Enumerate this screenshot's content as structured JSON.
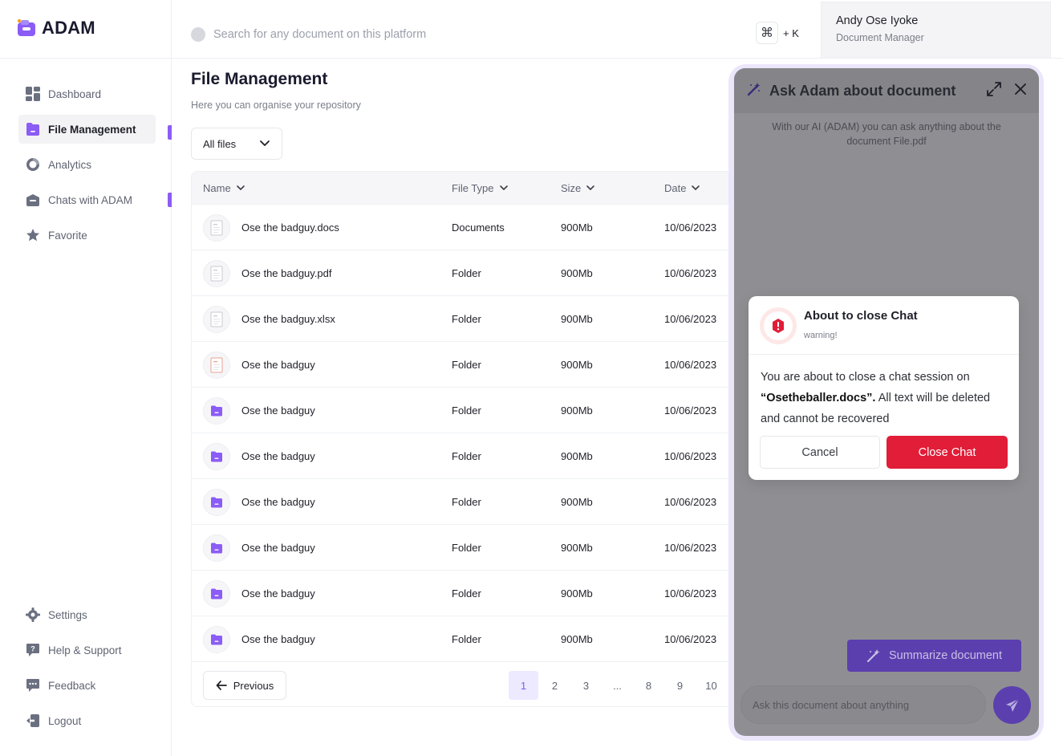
{
  "app": {
    "name": "ADAM",
    "accent": "#8b5cf6",
    "danger": "#e11d38"
  },
  "sidebar": {
    "items": [
      {
        "label": "Dashboard",
        "icon": "dashboard-icon",
        "active": false
      },
      {
        "label": "File Management",
        "icon": "folder-icon",
        "active": true
      },
      {
        "label": "Analytics",
        "icon": "analytics-icon",
        "active": false
      },
      {
        "label": "Chats with ADAM",
        "icon": "chat-box-icon",
        "active": false
      },
      {
        "label": "Favorite",
        "icon": "star-icon",
        "active": false
      }
    ],
    "bottom_items": [
      {
        "label": "Settings",
        "icon": "gear-icon"
      },
      {
        "label": "Help & Support",
        "icon": "help-icon"
      },
      {
        "label": "Feedback",
        "icon": "feedback-icon"
      },
      {
        "label": "Logout",
        "icon": "logout-icon"
      }
    ]
  },
  "header": {
    "search_placeholder": "Search for any document on this platform",
    "shortcut_key": "⌘",
    "shortcut_suffix": "+ K",
    "user_name": "Andy Ose Iyoke",
    "user_role": "Document Manager"
  },
  "main": {
    "title": "File Management",
    "subtitle": "Here you can organise your repository",
    "filter_value": "All files"
  },
  "table": {
    "columns": [
      "Name",
      "File Type",
      "Size",
      "Date"
    ],
    "rows": [
      {
        "name": "Ose the badguy.docs",
        "type": "Documents",
        "size": "900Mb",
        "date": "10/06/2023",
        "icon": "doc-file-icon"
      },
      {
        "name": "Ose the badguy.pdf",
        "type": "Folder",
        "size": "900Mb",
        "date": "10/06/2023",
        "icon": "pdf-file-icon"
      },
      {
        "name": "Ose the badguy.xlsx",
        "type": "Folder",
        "size": "900Mb",
        "date": "10/06/2023",
        "icon": "xls-file-icon"
      },
      {
        "name": "Ose the badguy",
        "type": "Folder",
        "size": "900Mb",
        "date": "10/06/2023",
        "icon": "image-file-icon"
      },
      {
        "name": "Ose the badguy",
        "type": "Folder",
        "size": "900Mb",
        "date": "10/06/2023",
        "icon": "folder-icon"
      },
      {
        "name": "Ose the badguy",
        "type": "Folder",
        "size": "900Mb",
        "date": "10/06/2023",
        "icon": "folder-icon"
      },
      {
        "name": "Ose the badguy",
        "type": "Folder",
        "size": "900Mb",
        "date": "10/06/2023",
        "icon": "folder-icon"
      },
      {
        "name": "Ose the badguy",
        "type": "Folder",
        "size": "900Mb",
        "date": "10/06/2023",
        "icon": "folder-icon"
      },
      {
        "name": "Ose the badguy",
        "type": "Folder",
        "size": "900Mb",
        "date": "10/06/2023",
        "icon": "folder-icon"
      },
      {
        "name": "Ose the badguy",
        "type": "Folder",
        "size": "900Mb",
        "date": "10/06/2023",
        "icon": "folder-icon"
      }
    ]
  },
  "pagination": {
    "prev_label": "Previous",
    "pages": [
      "1",
      "2",
      "3",
      "...",
      "8",
      "9",
      "10"
    ],
    "current": "1"
  },
  "chat": {
    "title": "Ask Adam about document",
    "intro": "With our AI (ADAM) you can ask anything about the document File.pdf",
    "summarize_label": "Summarize document",
    "input_placeholder": "Ask this document about anything"
  },
  "modal": {
    "title": "About to close Chat",
    "tag": "warning!",
    "body_prefix": "You are about to close a chat session on",
    "body_file": "“Osetheballer.docs”.",
    "body_suffix": "All text will be deleted and cannot be recovered",
    "cancel_label": "Cancel",
    "confirm_label": "Close Chat"
  }
}
